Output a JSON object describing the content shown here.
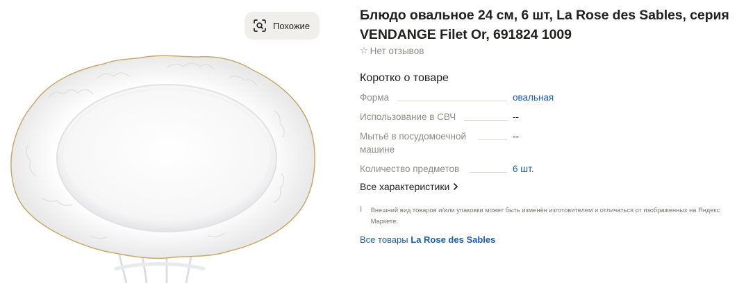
{
  "gallery": {
    "similar_button_label": "Похожие",
    "similar_icon": "lens-search-icon",
    "image_alt": "Блюдо овальное белое с рельефным узором и золотой каймой на подставке"
  },
  "product": {
    "title": "Блюдо овальное 24 см, 6 шт, La Rose des Sables, серия VENDANGE Filet Or, 691824 1009",
    "reviews_icon": "star-outline-icon",
    "reviews_text": "Нет отзывов"
  },
  "short_info": {
    "heading": "Коротко о товаре",
    "specs": [
      {
        "name": "Форма",
        "value": "овальная",
        "is_link": true
      },
      {
        "name": "Использование в СВЧ",
        "value": "--",
        "is_link": false
      },
      {
        "name": "Мытьё в посудомоечной машине",
        "value": "--",
        "is_link": false
      },
      {
        "name": "Количество предметов",
        "value": "6 шт.",
        "is_link": true
      }
    ],
    "all_specs_label": "Все характеристики",
    "all_specs_icon": "chevron-right-icon"
  },
  "notice": {
    "icon": "info-icon",
    "icon_glyph": "i",
    "text": "Внешний вид товаров и/или упаковки может быть изменён изготовителем и отличаться от изображенных на Яндекс Маркете."
  },
  "brand_link": {
    "prefix": "Все товары",
    "brand": "La Rose des Sables"
  },
  "colors": {
    "link": "#1a5bb8",
    "muted": "#8f8c87",
    "button_bg": "#f0efec"
  }
}
